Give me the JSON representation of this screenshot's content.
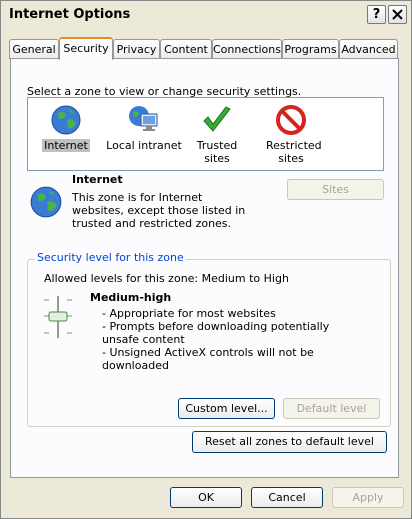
{
  "window": {
    "title": "Internet Options",
    "help_label": "?",
    "close_label": "X"
  },
  "tabs": [
    {
      "label": "General"
    },
    {
      "label": "Security"
    },
    {
      "label": "Privacy"
    },
    {
      "label": "Content"
    },
    {
      "label": "Connections"
    },
    {
      "label": "Programs"
    },
    {
      "label": "Advanced"
    }
  ],
  "security": {
    "instruction": "Select a zone to view or change security settings.",
    "zones": [
      {
        "label": "Internet",
        "icon": "globe-icon",
        "selected": true
      },
      {
        "label": "Local intranet",
        "icon": "computer-network-icon"
      },
      {
        "label": "Trusted sites",
        "icon": "checkmark-icon"
      },
      {
        "label": "Restricted sites",
        "icon": "restricted-icon"
      }
    ],
    "zone_detail": {
      "name": "Internet",
      "description": "This zone is for Internet websites, except those listed in trusted and restricted zones.",
      "sites_label": "Sites"
    },
    "level_group": {
      "title": "Security level for this zone",
      "allowed": "Allowed levels for this zone: Medium to High",
      "level_name": "Medium-high",
      "bullets": [
        "- Appropriate for most websites",
        "- Prompts before downloading potentially unsafe content",
        "- Unsigned ActiveX controls will not be downloaded"
      ],
      "custom_label": "Custom level...",
      "default_label": "Default level"
    },
    "reset_label": "Reset all zones to default level"
  },
  "footer": {
    "ok": "OK",
    "cancel": "Cancel",
    "apply": "Apply"
  }
}
